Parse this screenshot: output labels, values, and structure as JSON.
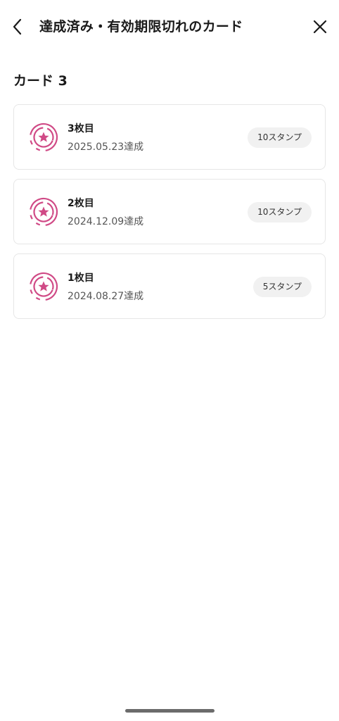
{
  "header": {
    "title": "達成済み・有効期限切れのカード",
    "back_icon": "chevron-left-icon",
    "close_icon": "close-icon"
  },
  "section": {
    "title": "カード 3"
  },
  "cards": [
    {
      "name": "3枚目",
      "date": "2025.05.23達成",
      "badge": "10スタンプ",
      "icon": "star-medal-icon"
    },
    {
      "name": "2枚目",
      "date": "2024.12.09達成",
      "badge": "10スタンプ",
      "icon": "star-medal-icon"
    },
    {
      "name": "1枚目",
      "date": "2024.08.27達成",
      "badge": "5スタンプ",
      "icon": "star-medal-icon"
    }
  ],
  "colors": {
    "accent": "#d04a86",
    "border": "#e6e6e6",
    "badge_bg": "#f1f1f1"
  }
}
